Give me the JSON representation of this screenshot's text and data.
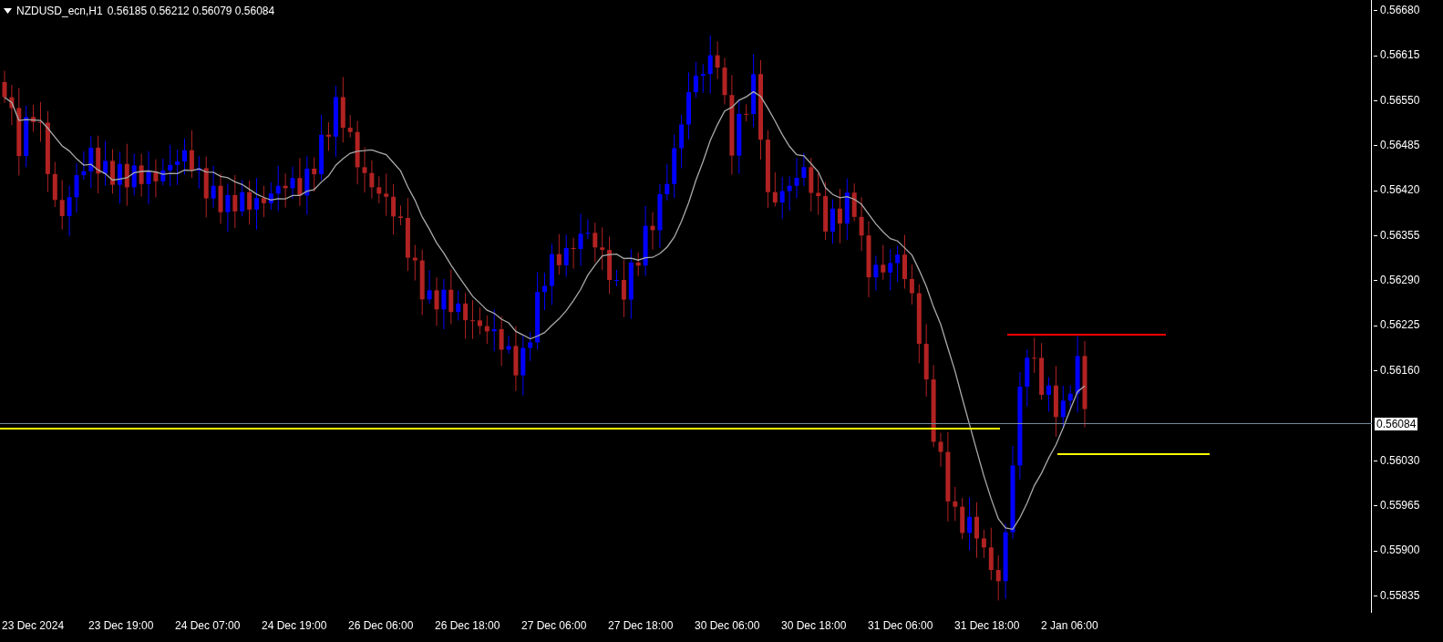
{
  "header": {
    "symbol": "NZDUSD_ecn,H1",
    "prices": "0.56185 0.56212 0.56079 0.56084"
  },
  "price_axis": [
    "0.56680",
    "0.56615",
    "0.56550",
    "0.56485",
    "0.56420",
    "0.56355",
    "0.56290",
    "0.56225",
    "0.56160",
    "0.56030",
    "0.55965",
    "0.55900",
    "0.55835"
  ],
  "current_price": "0.56084",
  "time_axis": [
    "23 Dec 2024",
    "23 Dec 19:00",
    "24 Dec 07:00",
    "24 Dec 19:00",
    "26 Dec 06:00",
    "26 Dec 18:00",
    "27 Dec 06:00",
    "27 Dec 18:00",
    "30 Dec 06:00",
    "30 Dec 18:00",
    "31 Dec 06:00",
    "31 Dec 18:00",
    "2 Jan 06:00"
  ]
}
